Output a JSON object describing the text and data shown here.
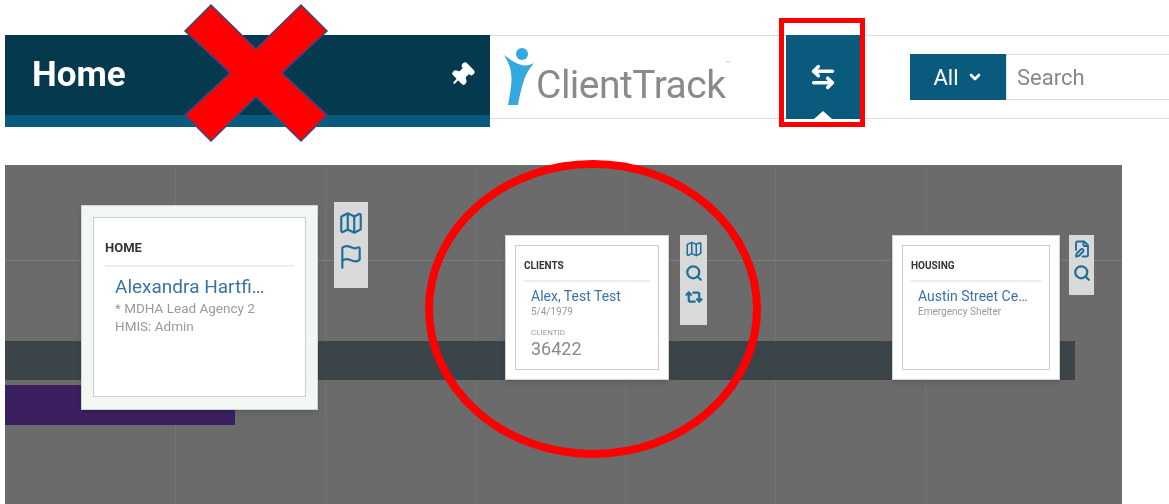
{
  "header": {
    "title": "Home"
  },
  "logo": {
    "text": "ClientTrack",
    "trademark": "™"
  },
  "search": {
    "scope": "All",
    "placeholder": "Search"
  },
  "cards": [
    {
      "heading": "HOME",
      "name": "Alexandra Hartfi…",
      "lines": [
        "* MDHA Lead Agency 2",
        "HMIS: Admin"
      ],
      "actions": [
        {
          "kind": "map"
        },
        {
          "kind": "flag"
        }
      ]
    },
    {
      "heading": "CLIENTS",
      "name": "Alex, Test Test",
      "lines": [
        "5/4/1979"
      ],
      "id_label": "CLIENTID",
      "id_value": "36422",
      "actions": [
        {
          "kind": "map"
        },
        {
          "kind": "search"
        },
        {
          "kind": "swap"
        }
      ]
    },
    {
      "heading": "HOUSING",
      "name": "Austin Street Ce…",
      "lines": [
        "Emergency Shelter"
      ],
      "actions": [
        {
          "kind": "edit"
        },
        {
          "kind": "search"
        }
      ]
    }
  ],
  "annotations": [
    {
      "kind": "cross"
    },
    {
      "kind": "box"
    },
    {
      "kind": "ellipse"
    }
  ]
}
